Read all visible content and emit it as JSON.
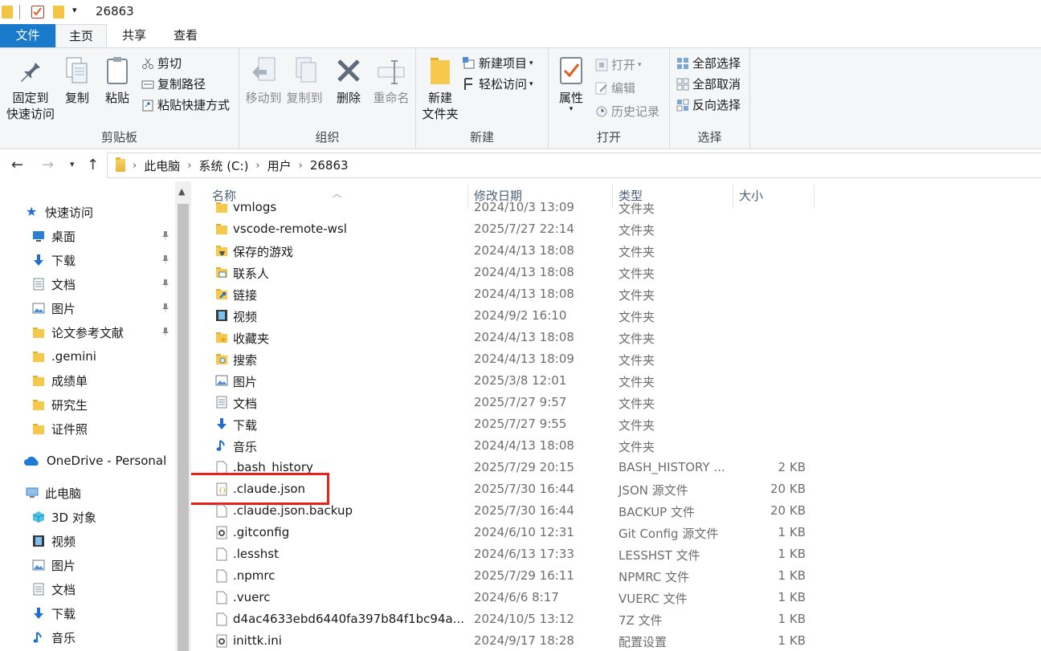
{
  "window": {
    "title": "26863"
  },
  "tabs": [
    {
      "label": "文件"
    },
    {
      "label": "主页"
    },
    {
      "label": "共享"
    },
    {
      "label": "查看"
    }
  ],
  "ribbon": {
    "clipboard": {
      "label": "剪贴板",
      "pin": "固定到\n快速访问",
      "copy": "复制",
      "paste": "粘贴",
      "cut": "剪切",
      "copy_path": "复制路径",
      "paste_shortcut": "粘贴快捷方式"
    },
    "organize": {
      "label": "组织",
      "move_to": "移动到",
      "copy_to": "复制到",
      "delete": "删除",
      "rename": "重命名"
    },
    "new": {
      "label": "新建",
      "new_folder": "新建\n文件夹",
      "new_item": "新建项目",
      "easy_access": "轻松访问"
    },
    "open": {
      "label": "打开",
      "properties": "属性",
      "open": "打开",
      "edit": "编辑",
      "history": "历史记录"
    },
    "select": {
      "label": "选择",
      "select_all": "全部选择",
      "select_none": "全部取消",
      "invert": "反向选择"
    }
  },
  "address": {
    "crumbs": [
      "此电脑",
      "系统 (C:)",
      "用户",
      "26863"
    ]
  },
  "nav": {
    "quick_access": "快速访问",
    "items": [
      {
        "label": "桌面",
        "icon": "desktop-icon",
        "pinned": true
      },
      {
        "label": "下载",
        "icon": "download-icon",
        "pinned": true
      },
      {
        "label": "文档",
        "icon": "document-icon",
        "pinned": true
      },
      {
        "label": "图片",
        "icon": "picture-icon",
        "pinned": true
      },
      {
        "label": "论文参考文献",
        "icon": "folder-icon",
        "pinned": true
      },
      {
        "label": ".gemini",
        "icon": "folder-icon",
        "pinned": false
      },
      {
        "label": "成绩单",
        "icon": "folder-icon",
        "pinned": false
      },
      {
        "label": "研究生",
        "icon": "folder-icon",
        "pinned": false
      },
      {
        "label": "证件照",
        "icon": "folder-icon",
        "pinned": false
      }
    ],
    "onedrive": "OneDrive - Personal",
    "this_pc": "此电脑",
    "pc_items": [
      {
        "label": "3D 对象",
        "icon": "3d-objects-icon"
      },
      {
        "label": "视频",
        "icon": "video-icon"
      },
      {
        "label": "图片",
        "icon": "picture-icon"
      },
      {
        "label": "文档",
        "icon": "document-icon"
      },
      {
        "label": "下载",
        "icon": "download-icon"
      },
      {
        "label": "音乐",
        "icon": "music-icon"
      }
    ]
  },
  "columns": {
    "name": "名称",
    "date": "修改日期",
    "type": "类型",
    "size": "大小"
  },
  "files": [
    {
      "name": "vmlogs",
      "date": "2024/10/3 13:09",
      "type": "文件夹",
      "size": "",
      "icon": "folder-icon"
    },
    {
      "name": "vscode-remote-wsl",
      "date": "2025/7/27 22:14",
      "type": "文件夹",
      "size": "",
      "icon": "folder-icon"
    },
    {
      "name": "保存的游戏",
      "date": "2024/4/13 18:08",
      "type": "文件夹",
      "size": "",
      "icon": "saved-games-icon"
    },
    {
      "name": "联系人",
      "date": "2024/4/13 18:08",
      "type": "文件夹",
      "size": "",
      "icon": "contacts-icon"
    },
    {
      "name": "链接",
      "date": "2024/4/13 18:08",
      "type": "文件夹",
      "size": "",
      "icon": "links-icon"
    },
    {
      "name": "视频",
      "date": "2024/9/2 16:10",
      "type": "文件夹",
      "size": "",
      "icon": "video-icon"
    },
    {
      "name": "收藏夹",
      "date": "2024/4/13 18:08",
      "type": "文件夹",
      "size": "",
      "icon": "favorites-icon"
    },
    {
      "name": "搜索",
      "date": "2024/4/13 18:09",
      "type": "文件夹",
      "size": "",
      "icon": "search-folder-icon"
    },
    {
      "name": "图片",
      "date": "2025/3/8 12:01",
      "type": "文件夹",
      "size": "",
      "icon": "picture-icon"
    },
    {
      "name": "文档",
      "date": "2025/7/27 9:57",
      "type": "文件夹",
      "size": "",
      "icon": "document-icon"
    },
    {
      "name": "下载",
      "date": "2025/7/27 9:55",
      "type": "文件夹",
      "size": "",
      "icon": "download-icon"
    },
    {
      "name": "音乐",
      "date": "2024/4/13 18:08",
      "type": "文件夹",
      "size": "",
      "icon": "music-icon"
    },
    {
      "name": ".bash_history",
      "date": "2025/7/29 20:15",
      "type": "BASH_HISTORY ...",
      "size": "2 KB",
      "icon": "file-icon"
    },
    {
      "name": ".claude.json",
      "date": "2025/7/30 16:44",
      "type": "JSON 源文件",
      "size": "20 KB",
      "icon": "json-file-icon",
      "highlighted": true
    },
    {
      "name": ".claude.json.backup",
      "date": "2025/7/30 16:44",
      "type": "BACKUP 文件",
      "size": "20 KB",
      "icon": "file-icon"
    },
    {
      "name": ".gitconfig",
      "date": "2024/6/10 12:31",
      "type": "Git Config 源文件",
      "size": "1 KB",
      "icon": "config-file-icon"
    },
    {
      "name": ".lesshst",
      "date": "2024/6/13 17:33",
      "type": "LESSHST 文件",
      "size": "1 KB",
      "icon": "file-icon"
    },
    {
      "name": ".npmrc",
      "date": "2025/7/29 16:11",
      "type": "NPMRC 文件",
      "size": "1 KB",
      "icon": "file-icon"
    },
    {
      "name": ".vuerc",
      "date": "2024/6/6 8:17",
      "type": "VUERC 文件",
      "size": "1 KB",
      "icon": "file-icon"
    },
    {
      "name": "d4ac4633ebd6440fa397b84f1bc94a...",
      "date": "2024/10/5 13:12",
      "type": "7Z 文件",
      "size": "1 KB",
      "icon": "file-icon"
    },
    {
      "name": "inittk.ini",
      "date": "2024/9/17 18:28",
      "type": "配置设置",
      "size": "1 KB",
      "icon": "config-file-icon"
    }
  ],
  "colors": {
    "accent": "#1979ca",
    "highlight": "#e8221b",
    "folder": "#f4c542"
  }
}
